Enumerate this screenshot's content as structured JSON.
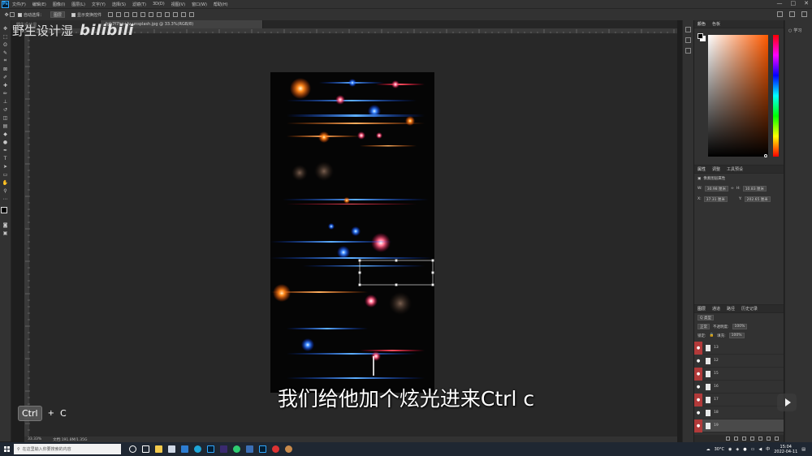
{
  "menubar": {
    "items": [
      "文件(F)",
      "编辑(E)",
      "图像(I)",
      "图层(L)",
      "文字(Y)",
      "选择(S)",
      "滤镜(T)",
      "3D(D)",
      "视图(V)",
      "窗口(W)",
      "帮助(H)"
    ],
    "window_controls": [
      "—",
      "□",
      "✕"
    ]
  },
  "optionsbar": {
    "auto_select_label": "自动选择：",
    "auto_select_value": "图层",
    "show_transform_label": "显示变换控件"
  },
  "tabs": [
    {
      "label": "野生设计湿",
      "active": false
    },
    {
      "label": "fgb7f7hp+Jv-unsplash.jpg @ 33.3%(RGB/8)",
      "active": true
    }
  ],
  "watermark": {
    "name": "野生设计湿",
    "logo": "bilibili"
  },
  "subtitle": "我们给他加个炫光进来Ctrl c",
  "keycaps": {
    "key1": "Ctrl",
    "plus": "+",
    "key2": "C"
  },
  "statusbar": {
    "zoom": "33.33%",
    "doc": "文档:191.8M/1.35G"
  },
  "right_panel": {
    "learn": "学习",
    "color_tabs": [
      "颜色",
      "色板"
    ],
    "props_tabs": [
      "属性",
      "调整",
      "工具预设"
    ],
    "props_title": "像素图层属性",
    "w_label": "W:",
    "w_value": "30.98 厘米",
    "h_label": "H:",
    "h_value": "10.83 厘米",
    "x_label": "X:",
    "x_value": "37.31 厘米",
    "y_label": "Y:",
    "y_value": "202.65 厘米",
    "layers_tabs": [
      "图层",
      "通道",
      "路径",
      "历史记录"
    ],
    "kind_label": "Q 类型",
    "mode_label": "正常",
    "opacity_label": "不透明度:",
    "opacity_value": "100%",
    "lock_label": "锁定:",
    "fill_label": "填充:",
    "fill_value": "100%",
    "layers": [
      {
        "name": "13",
        "eye_red": true
      },
      {
        "name": "12",
        "eye_red": false
      },
      {
        "name": "15",
        "eye_red": true
      },
      {
        "name": "16",
        "eye_red": false
      },
      {
        "name": "17",
        "eye_red": true
      },
      {
        "name": "18",
        "eye_red": false
      },
      {
        "name": "19",
        "eye_red": true
      }
    ]
  },
  "taskbar": {
    "search_placeholder": "在这里输入你要搜索的内容",
    "temperature": "30°C",
    "ime": "中",
    "time": "15:04",
    "date": "2022-04-11"
  },
  "colors": {
    "accent_red": "#b23a3a",
    "ps_blue": "#31a8ff"
  }
}
